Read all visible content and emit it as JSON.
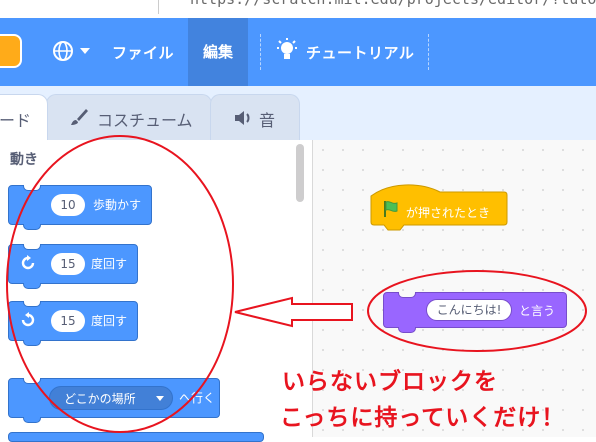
{
  "address_bar": {
    "url": "https://scratch.mit.edu/projects/editor/?tutorial=gets"
  },
  "menu": {
    "file_label": "ファイル",
    "edit_label": "編集",
    "tutorial_label": "チュートリアル"
  },
  "tabs": {
    "code": "ード",
    "costume": "コスチューム",
    "sound": "音"
  },
  "palette": {
    "category": "動き",
    "blocks": [
      {
        "value": "10",
        "text": "歩動かす"
      },
      {
        "value": "15",
        "text": "度回す",
        "icon": "rotate-right-icon"
      },
      {
        "value": "15",
        "text": "度回す",
        "icon": "rotate-left-icon"
      },
      {
        "dropdown": "どこかの場所",
        "text": "へ行く"
      }
    ]
  },
  "script": {
    "hat_label": "が押されたとき",
    "say_value": "こんにちは!",
    "say_label": "と言う"
  },
  "annotation": {
    "line1": "いらないブロックを",
    "line2": "こっちに持っていくだけ！",
    "color": "#e8141f"
  },
  "colors": {
    "menu_bar": "#4c97ff",
    "motion_block": "#4c97ff",
    "looks_block": "#9966ff",
    "events_block": "#ffbf00"
  }
}
